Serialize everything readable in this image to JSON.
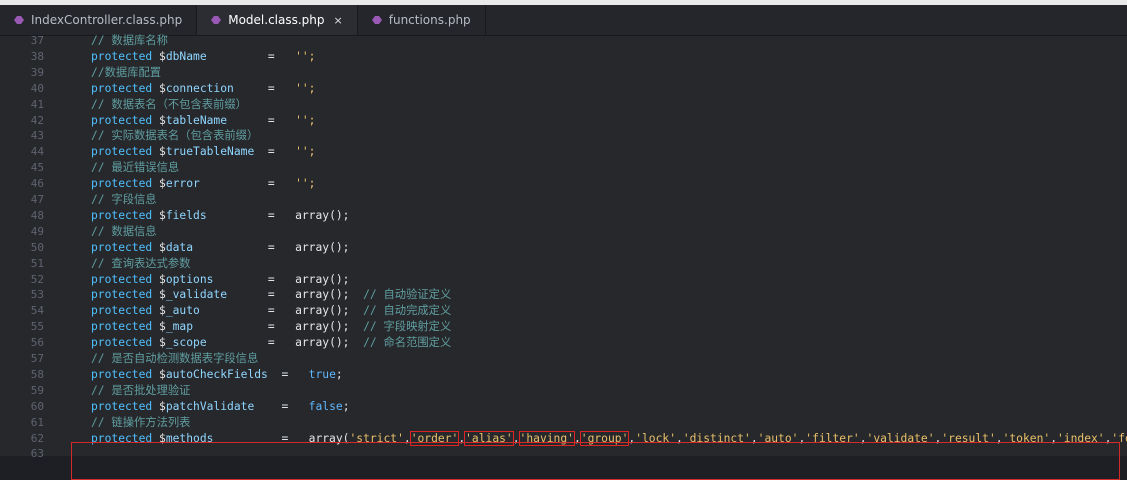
{
  "tabs": [
    {
      "label": "IndexController.class.php",
      "active": false
    },
    {
      "label": "Model.class.php",
      "active": true,
      "close": "×"
    },
    {
      "label": "functions.php",
      "active": false
    }
  ],
  "colors": {
    "tab_icon": "#9b59b6",
    "highlight_box": "#d42a2a",
    "keyword": "#4fc1ff"
  },
  "lines": [
    {
      "n": "37",
      "parts": [
        {
          "t": "// 数据库名称",
          "c": "cm"
        }
      ]
    },
    {
      "n": "38",
      "parts": [
        {
          "t": "protected ",
          "c": "kw"
        },
        {
          "t": "$",
          "c": "dollar"
        },
        {
          "t": "dbName",
          "c": "var"
        },
        {
          "t": "         =   ",
          "c": "op"
        },
        {
          "t": "'';",
          "c": "str"
        }
      ]
    },
    {
      "n": "39",
      "parts": [
        {
          "t": "//数据库配置",
          "c": "cm"
        }
      ]
    },
    {
      "n": "40",
      "parts": [
        {
          "t": "protected ",
          "c": "kw"
        },
        {
          "t": "$",
          "c": "dollar"
        },
        {
          "t": "connection",
          "c": "var"
        },
        {
          "t": "     =   ",
          "c": "op"
        },
        {
          "t": "'';",
          "c": "str"
        }
      ]
    },
    {
      "n": "41",
      "parts": [
        {
          "t": "// 数据表名（不包含表前缀）",
          "c": "cm"
        }
      ]
    },
    {
      "n": "42",
      "parts": [
        {
          "t": "protected ",
          "c": "kw"
        },
        {
          "t": "$",
          "c": "dollar"
        },
        {
          "t": "tableName",
          "c": "var"
        },
        {
          "t": "      =   ",
          "c": "op"
        },
        {
          "t": "'';",
          "c": "str"
        }
      ]
    },
    {
      "n": "43",
      "parts": [
        {
          "t": "// 实际数据表名（包含表前缀）",
          "c": "cm"
        }
      ]
    },
    {
      "n": "44",
      "parts": [
        {
          "t": "protected ",
          "c": "kw"
        },
        {
          "t": "$",
          "c": "dollar"
        },
        {
          "t": "trueTableName",
          "c": "var"
        },
        {
          "t": "  =   ",
          "c": "op"
        },
        {
          "t": "'';",
          "c": "str"
        }
      ]
    },
    {
      "n": "45",
      "parts": [
        {
          "t": "// 最近错误信息",
          "c": "cm"
        }
      ]
    },
    {
      "n": "46",
      "parts": [
        {
          "t": "protected ",
          "c": "kw"
        },
        {
          "t": "$",
          "c": "dollar"
        },
        {
          "t": "error",
          "c": "var"
        },
        {
          "t": "          =   ",
          "c": "op"
        },
        {
          "t": "'';",
          "c": "str"
        }
      ]
    },
    {
      "n": "47",
      "parts": [
        {
          "t": "// 字段信息",
          "c": "cm"
        }
      ]
    },
    {
      "n": "48",
      "parts": [
        {
          "t": "protected ",
          "c": "kw"
        },
        {
          "t": "$",
          "c": "dollar"
        },
        {
          "t": "fields",
          "c": "var"
        },
        {
          "t": "         =   ",
          "c": "op"
        },
        {
          "t": "array();",
          "c": "fn"
        }
      ]
    },
    {
      "n": "49",
      "parts": [
        {
          "t": "// 数据信息",
          "c": "cm"
        }
      ]
    },
    {
      "n": "50",
      "parts": [
        {
          "t": "protected ",
          "c": "kw"
        },
        {
          "t": "$",
          "c": "dollar"
        },
        {
          "t": "data",
          "c": "var"
        },
        {
          "t": "           =   ",
          "c": "op"
        },
        {
          "t": "array();",
          "c": "fn"
        }
      ]
    },
    {
      "n": "51",
      "parts": [
        {
          "t": "// 查询表达式参数",
          "c": "cm"
        }
      ]
    },
    {
      "n": "52",
      "parts": [
        {
          "t": "protected ",
          "c": "kw"
        },
        {
          "t": "$",
          "c": "dollar"
        },
        {
          "t": "options",
          "c": "var"
        },
        {
          "t": "        =   ",
          "c": "op"
        },
        {
          "t": "array();",
          "c": "fn"
        }
      ]
    },
    {
      "n": "53",
      "parts": [
        {
          "t": "protected ",
          "c": "kw"
        },
        {
          "t": "$",
          "c": "dollar"
        },
        {
          "t": "_validate",
          "c": "var"
        },
        {
          "t": "      =   ",
          "c": "op"
        },
        {
          "t": "array();  ",
          "c": "fn"
        },
        {
          "t": "// 自动验证定义",
          "c": "cm"
        }
      ]
    },
    {
      "n": "54",
      "parts": [
        {
          "t": "protected ",
          "c": "kw"
        },
        {
          "t": "$",
          "c": "dollar"
        },
        {
          "t": "_auto",
          "c": "var"
        },
        {
          "t": "          =   ",
          "c": "op"
        },
        {
          "t": "array();  ",
          "c": "fn"
        },
        {
          "t": "// 自动完成定义",
          "c": "cm"
        }
      ]
    },
    {
      "n": "55",
      "parts": [
        {
          "t": "protected ",
          "c": "kw"
        },
        {
          "t": "$",
          "c": "dollar"
        },
        {
          "t": "_map",
          "c": "var"
        },
        {
          "t": "           =   ",
          "c": "op"
        },
        {
          "t": "array();  ",
          "c": "fn"
        },
        {
          "t": "// 字段映射定义",
          "c": "cm"
        }
      ]
    },
    {
      "n": "56",
      "parts": [
        {
          "t": "protected ",
          "c": "kw"
        },
        {
          "t": "$",
          "c": "dollar"
        },
        {
          "t": "_scope",
          "c": "var"
        },
        {
          "t": "         =   ",
          "c": "op"
        },
        {
          "t": "array();  ",
          "c": "fn"
        },
        {
          "t": "// 命名范围定义",
          "c": "cm"
        }
      ]
    },
    {
      "n": "57",
      "parts": [
        {
          "t": "// 是否自动检测数据表字段信息",
          "c": "cm"
        }
      ]
    },
    {
      "n": "58",
      "parts": [
        {
          "t": "protected ",
          "c": "kw"
        },
        {
          "t": "$",
          "c": "dollar"
        },
        {
          "t": "autoCheckFields",
          "c": "var"
        },
        {
          "t": "  =   ",
          "c": "op"
        },
        {
          "t": "true",
          "c": "bool"
        },
        {
          "t": ";",
          "c": "op"
        }
      ]
    },
    {
      "n": "59",
      "parts": [
        {
          "t": "// 是否批处理验证",
          "c": "cm"
        }
      ]
    },
    {
      "n": "60",
      "parts": [
        {
          "t": "protected ",
          "c": "kw"
        },
        {
          "t": "$",
          "c": "dollar"
        },
        {
          "t": "patchValidate",
          "c": "var"
        },
        {
          "t": "    =   ",
          "c": "op"
        },
        {
          "t": "false",
          "c": "bool"
        },
        {
          "t": ";",
          "c": "op"
        }
      ]
    },
    {
      "n": "61",
      "parts": [
        {
          "t": "// 链操作方法列表",
          "c": "cm"
        }
      ]
    },
    {
      "n": "62",
      "parts": [
        {
          "t": "protected ",
          "c": "kw"
        },
        {
          "t": "$",
          "c": "dollar"
        },
        {
          "t": "methods",
          "c": "var"
        },
        {
          "t": "          =   ",
          "c": "op"
        },
        {
          "t": "array(",
          "c": "fn"
        },
        {
          "t": "'strict'",
          "c": "str"
        },
        {
          "t": ",",
          "c": "op"
        },
        {
          "t": "'order'",
          "c": "str",
          "box": true
        },
        {
          "t": ",",
          "c": "op"
        },
        {
          "t": "'alias'",
          "c": "str",
          "box": true
        },
        {
          "t": ",",
          "c": "op"
        },
        {
          "t": "'having'",
          "c": "str",
          "box": true
        },
        {
          "t": ",",
          "c": "op"
        },
        {
          "t": "'group'",
          "c": "str",
          "box": true
        },
        {
          "t": ",",
          "c": "op"
        },
        {
          "t": "'lock'",
          "c": "str"
        },
        {
          "t": ",",
          "c": "op"
        },
        {
          "t": "'distinct'",
          "c": "str"
        },
        {
          "t": ",",
          "c": "op"
        },
        {
          "t": "'auto'",
          "c": "str"
        },
        {
          "t": ",",
          "c": "op"
        },
        {
          "t": "'filter'",
          "c": "str"
        },
        {
          "t": ",",
          "c": "op"
        },
        {
          "t": "'validate'",
          "c": "str"
        },
        {
          "t": ",",
          "c": "op"
        },
        {
          "t": "'result'",
          "c": "str"
        },
        {
          "t": ",",
          "c": "op"
        },
        {
          "t": "'token'",
          "c": "str"
        },
        {
          "t": ",",
          "c": "op"
        },
        {
          "t": "'index'",
          "c": "str"
        },
        {
          "t": ",",
          "c": "op"
        },
        {
          "t": "'force'",
          "c": "str"
        },
        {
          "t": ");",
          "c": "fn"
        }
      ]
    },
    {
      "n": "63",
      "parts": []
    }
  ]
}
